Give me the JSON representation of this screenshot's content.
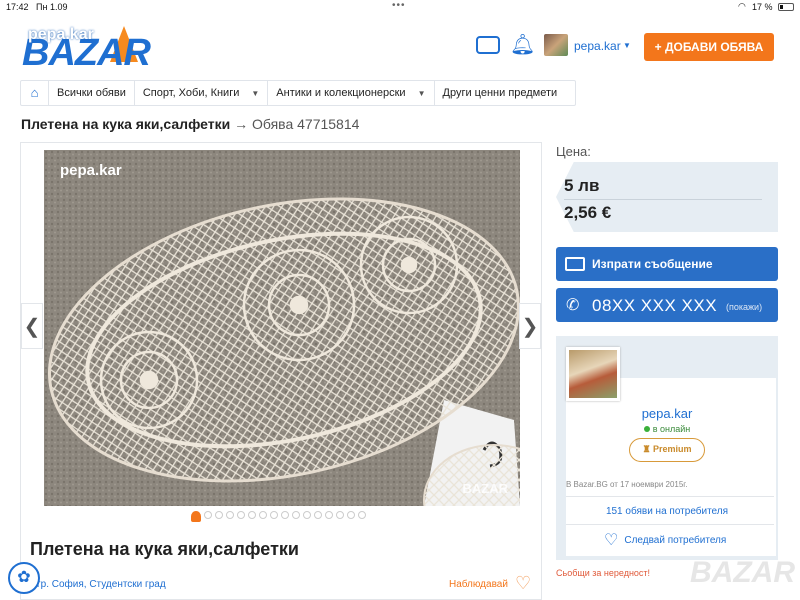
{
  "status": {
    "time": "17:42",
    "date": "Пн 1.09",
    "battery": "17 %"
  },
  "header": {
    "logo_domain": "pepa.kar",
    "logo_word": "BAZAR",
    "username": "pepa.kar",
    "add_button": "+ ДОБАВИ ОБЯВА"
  },
  "breadcrumb": {
    "items": [
      "Всички обяви",
      "Спорт, Хоби, Книги",
      "Антики и колекционерски",
      "Други ценни предмети"
    ]
  },
  "listing": {
    "title": "Плетена на кука яки,салфетки",
    "arrow": "→",
    "ad_number": "Обява 47715814",
    "heading": "Плетена на кука яки,салфетки",
    "location": "гр. София, Студентски град",
    "watch_label": "Наблюдавай",
    "photo_watermark": "pepa.kar",
    "photo_brand": "BAZAR",
    "photo_count": 16,
    "active_photo": 1
  },
  "price": {
    "label": "Цена:",
    "bgn": "5 лв",
    "eur": "2,56 €"
  },
  "actions": {
    "message": "Изпрати съобщение",
    "phone": "08XX XXX XXX",
    "phone_show": "(покажи)"
  },
  "seller": {
    "name": "pepa.kar",
    "status": "в онлайн",
    "badge": "Premium",
    "since": "В Bazar.BG от 17 ноември 2015г.",
    "ads_count": "151 обяви на потребителя",
    "follow": "Следвай потребителя",
    "report": "Сьобщи за нередност!"
  },
  "footer_brand": "BAZAR"
}
